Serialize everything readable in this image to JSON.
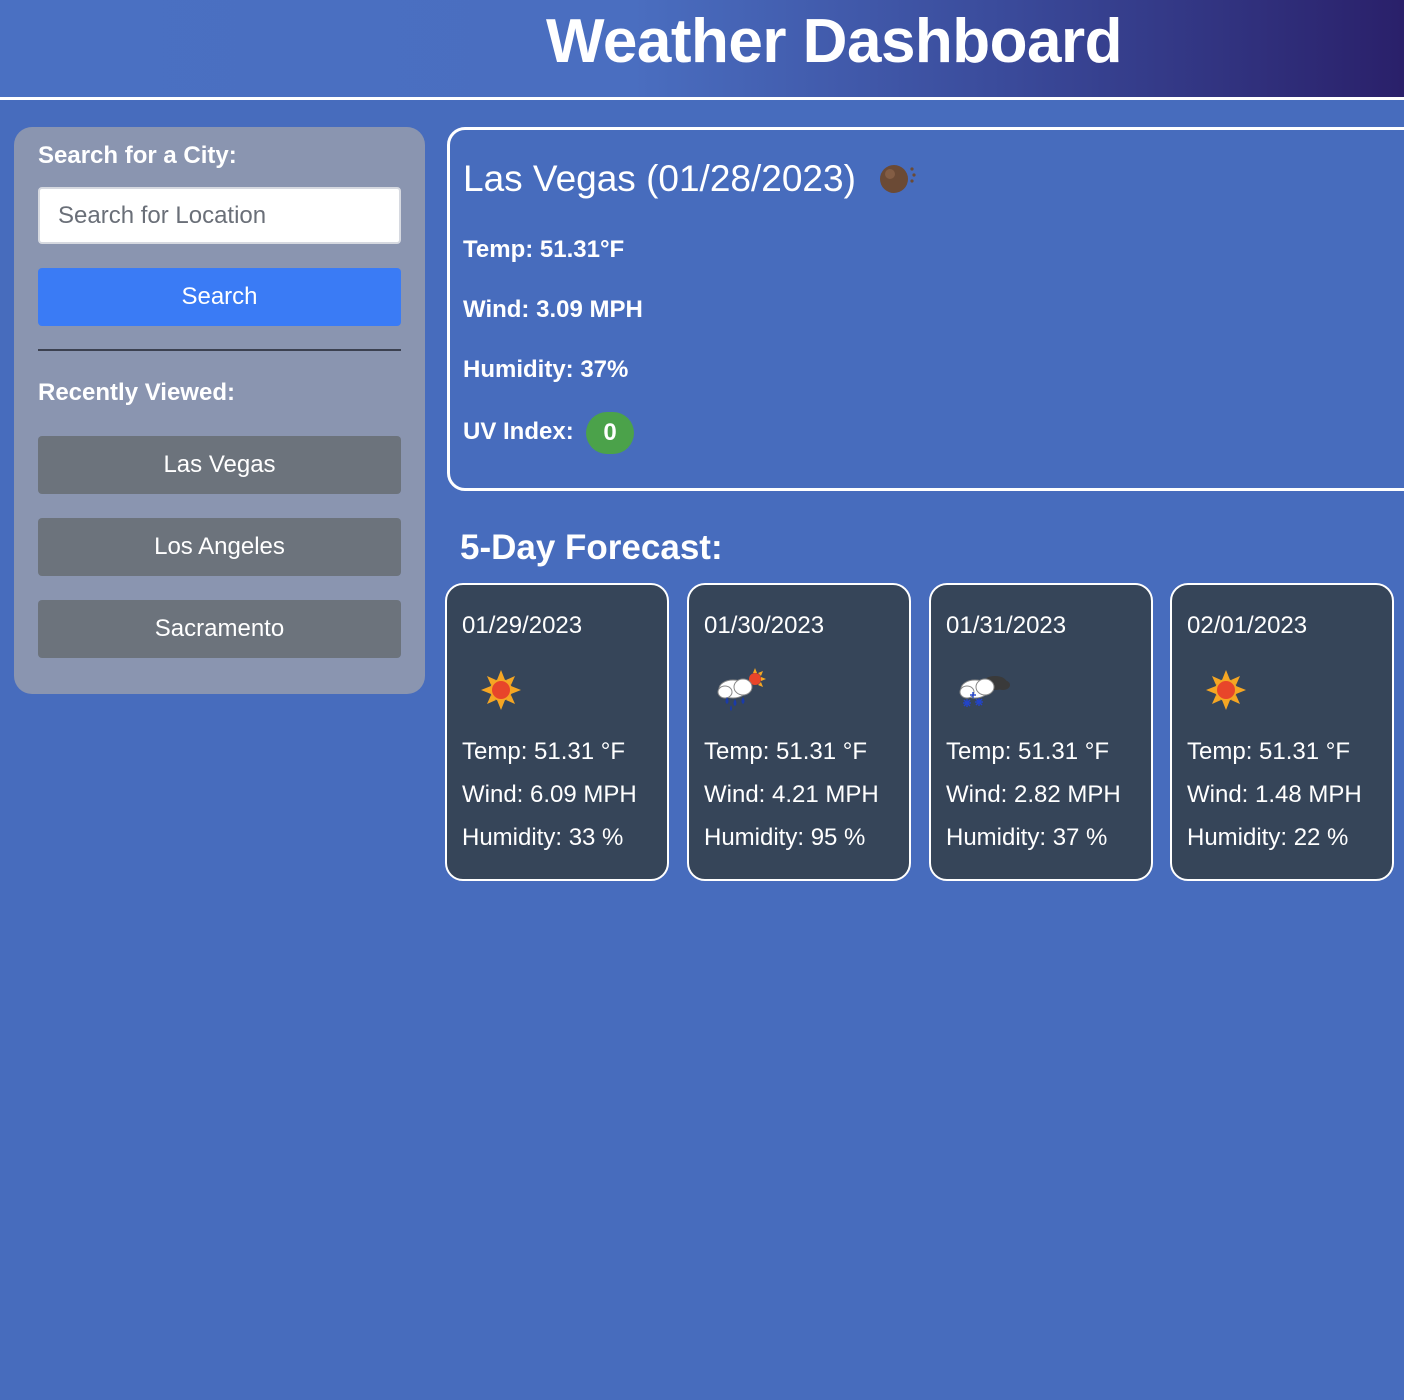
{
  "header": {
    "title": "Weather Dashboard"
  },
  "sidebar": {
    "search_label": "Search for a City:",
    "search_placeholder": "Search for Location",
    "search_button": "Search",
    "recent_label": "Recently Viewed:",
    "recent": [
      "Las Vegas",
      "Los Angeles",
      "Sacramento"
    ]
  },
  "current": {
    "title": "Las Vegas (01/28/2023)",
    "icon": "moon-clouds-icon",
    "temp": "Temp: 51.31°F",
    "wind": "Wind: 3.09 MPH",
    "humidity": "Humidity: 37%",
    "uv_label": "UV Index:",
    "uv_value": "0",
    "uv_color": "#4ba24a"
  },
  "forecast": {
    "title": "5-Day Forecast:",
    "days": [
      {
        "date": "01/29/2023",
        "icon": "sun-icon",
        "temp": "Temp: 51.31 °F",
        "wind": "Wind: 6.09 MPH",
        "humidity": "Humidity: 33 %"
      },
      {
        "date": "01/30/2023",
        "icon": "rain-sun-icon",
        "temp": "Temp: 51.31 °F",
        "wind": "Wind: 4.21 MPH",
        "humidity": "Humidity: 95 %"
      },
      {
        "date": "01/31/2023",
        "icon": "snow-cloud-icon",
        "temp": "Temp: 51.31 °F",
        "wind": "Wind: 2.82 MPH",
        "humidity": "Humidity: 37 %"
      },
      {
        "date": "02/01/2023",
        "icon": "sun-icon",
        "temp": "Temp: 51.31 °F",
        "wind": "Wind: 1.48 MPH",
        "humidity": "Humidity: 22 %"
      }
    ]
  }
}
